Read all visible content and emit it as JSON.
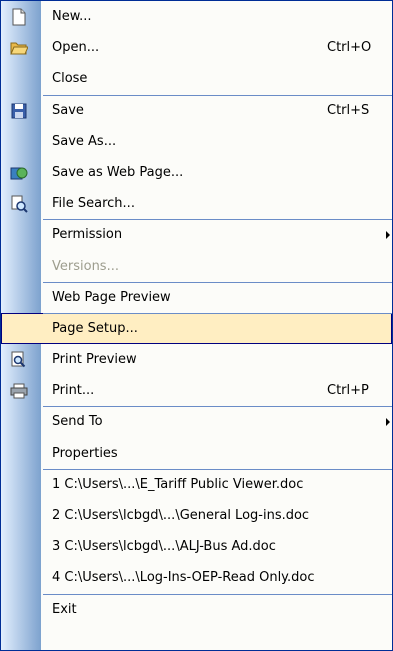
{
  "menu": {
    "items": [
      {
        "label": "New...",
        "icon": "new-document-icon"
      },
      {
        "label": "Open...",
        "shortcut": "Ctrl+O",
        "icon": "open-folder-icon"
      },
      {
        "label": "Close"
      },
      {
        "label": "Save",
        "shortcut": "Ctrl+S",
        "icon": "save-floppy-icon"
      },
      {
        "label": "Save As..."
      },
      {
        "label": "Save as Web Page...",
        "icon": "save-web-page-icon"
      },
      {
        "label": "File Search...",
        "icon": "file-search-icon"
      },
      {
        "label": "Permission",
        "submenu": true
      },
      {
        "label": "Versions...",
        "disabled": true
      },
      {
        "label": "Web Page Preview"
      },
      {
        "label": "Page Setup...",
        "highlighted": true
      },
      {
        "label": "Print Preview",
        "icon": "print-preview-icon"
      },
      {
        "label": "Print...",
        "shortcut": "Ctrl+P",
        "icon": "printer-icon"
      },
      {
        "label": "Send To",
        "submenu": true
      },
      {
        "label": "Properties"
      },
      {
        "label": "1 C:\\Users\\...\\E_Tariff Public Viewer.doc"
      },
      {
        "label": "2 C:\\Users\\lcbgd\\...\\General Log-ins.doc"
      },
      {
        "label": "3 C:\\Users\\lcbgd\\...\\ALJ-Bus Ad.doc"
      },
      {
        "label": "4 C:\\Users\\...\\Log-Ins-OEP-Read Only.doc"
      },
      {
        "label": "Exit"
      }
    ]
  },
  "colors": {
    "border": "#002d96",
    "gutter_start": "#e3effe",
    "gutter_end": "#7da2ce",
    "highlight_fill": "#ffeec2",
    "highlight_border": "#000080",
    "disabled_text": "#9d9d8e"
  }
}
